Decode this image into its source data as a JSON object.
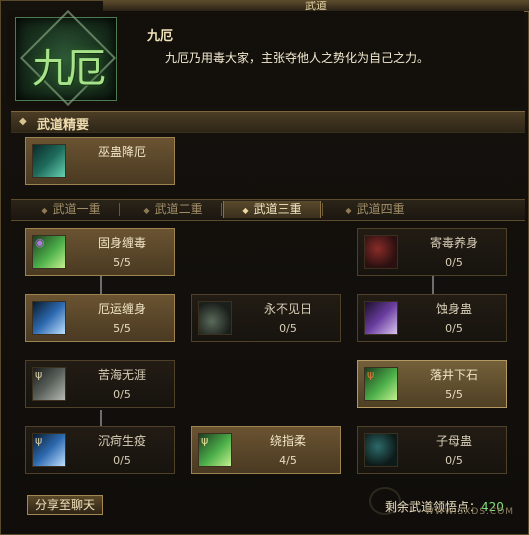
{
  "window": {
    "title": "武道"
  },
  "school": {
    "emblem_text": "九厄",
    "name": "九厄",
    "description": "九厄乃用毒大家，主张夺他人之势化为自己之力。"
  },
  "essence_section": {
    "label": "武道精要",
    "skill": {
      "name": "巫蛊降厄",
      "icon": "green-spirit-icon"
    }
  },
  "tabs": [
    {
      "label": "武道一重",
      "active": false
    },
    {
      "label": "武道二重",
      "active": false
    },
    {
      "label": "武道三重",
      "active": true
    },
    {
      "label": "武道四重",
      "active": false
    }
  ],
  "skills": {
    "s1": {
      "name": "固身缠毒",
      "level": "5/5",
      "icon": "purple-vine-icon"
    },
    "s2": {
      "name": "寄毒养身",
      "level": "0/5",
      "icon": "red-cauldron-icon"
    },
    "s3": {
      "name": "厄运缠身",
      "level": "5/5",
      "icon": "blue-gauntlet-icon"
    },
    "s4": {
      "name": "永不见日",
      "level": "0/5",
      "icon": "dark-shadow-icon"
    },
    "s5": {
      "name": "蚀身蛊",
      "level": "0/5",
      "icon": "purple-gauntlet-icon"
    },
    "s6": {
      "name": "苦海无涯",
      "level": "0/5",
      "icon": "gray-claw-icon"
    },
    "s7": {
      "name": "落井下石",
      "level": "5/5",
      "icon": "green-hand-icon"
    },
    "s8": {
      "name": "沉疴生疫",
      "level": "0/5",
      "icon": "blue-slash-icon"
    },
    "s9": {
      "name": "绕指柔",
      "level": "4/5",
      "icon": "green-claw-icon"
    },
    "s10": {
      "name": "子母蛊",
      "level": "0/5",
      "icon": "black-teal-orb-icon"
    }
  },
  "footer": {
    "share_label": "分享至聊天",
    "points_label": "剩余武道领悟点：",
    "points_value": "420",
    "watermark": "WWW.SXDS.COM"
  }
}
